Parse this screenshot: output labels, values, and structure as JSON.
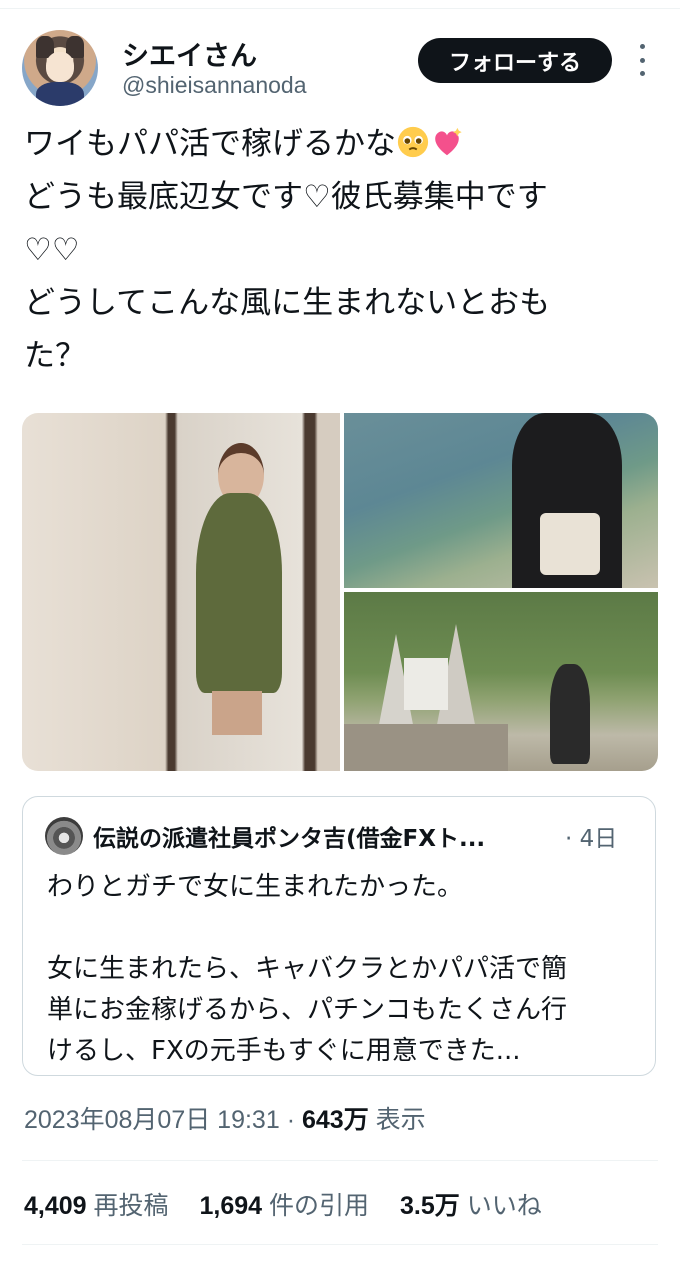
{
  "author": {
    "name": "シエイさん",
    "handle": "@shieisannanoda",
    "follow_label": "フォローする"
  },
  "tweet": {
    "text_line1": "ワイもパパ活で稼げるかな",
    "text_rest": "どうも最底辺女です♡彼氏募集中です\n♡♡\nどうしてこんな風に生まれないとおも\nた？",
    "emoji_icons": [
      "pleading-face-icon",
      "sparkling-heart-icon"
    ]
  },
  "quoted": {
    "name": "伝説の派遣社員ポンタ吉(借金FXト...",
    "time": "· 4日",
    "text": "わりとガチで女に生まれたかった。\n\n女に生まれたら、キャバクラとかパパ活で簡\n単にお金稼げるから、パチンコもたくさん行\nけるし、FXの元手もすぐに用意できた..."
  },
  "meta": {
    "datetime": "2023年08月07日 19:31",
    "dot": "·",
    "views_count": "643万",
    "views_label": "表示"
  },
  "stats": {
    "reposts_count": "4,409",
    "reposts_label": "再投稿",
    "quotes_count": "1,694",
    "quotes_label": "件の引用",
    "likes_count": "3.5万",
    "likes_label": "いいね"
  },
  "colors": {
    "text": "#0f1419",
    "secondary": "#536471",
    "border": "#cfd9de",
    "button_bg": "#0f1419"
  }
}
